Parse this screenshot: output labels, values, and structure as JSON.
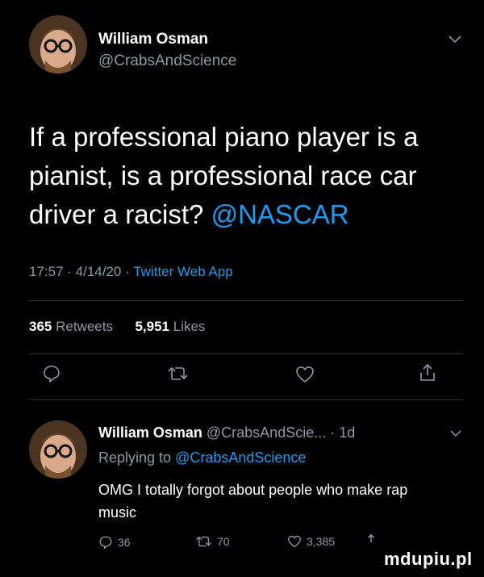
{
  "main_tweet": {
    "author_name": "William Osman",
    "author_handle": "@CrabsAndScience",
    "text_part1": "If a professional piano player is a pianist, is a professional race car driver a racist?",
    "mention": "@NASCAR",
    "time": "17:57",
    "date": "4/14/20",
    "source": "Twitter Web App",
    "retweets_count": "365",
    "retweets_label": "Retweets",
    "likes_count": "5,951",
    "likes_label": "Likes"
  },
  "reply": {
    "author_name": "William Osman",
    "author_handle": "@CrabsAndScie...",
    "time_ago": "1d",
    "replying_label": "Replying to",
    "replying_handle": "@CrabsAndScience",
    "text": "OMG I totally forgot about people who make rap music",
    "reply_count": "36",
    "retweet_count": "70",
    "like_count": "3,385"
  },
  "watermark": "mdupiu.pl",
  "colors": {
    "background": "#000000",
    "accent": "#1d9bf0",
    "muted": "#8b98a5"
  }
}
